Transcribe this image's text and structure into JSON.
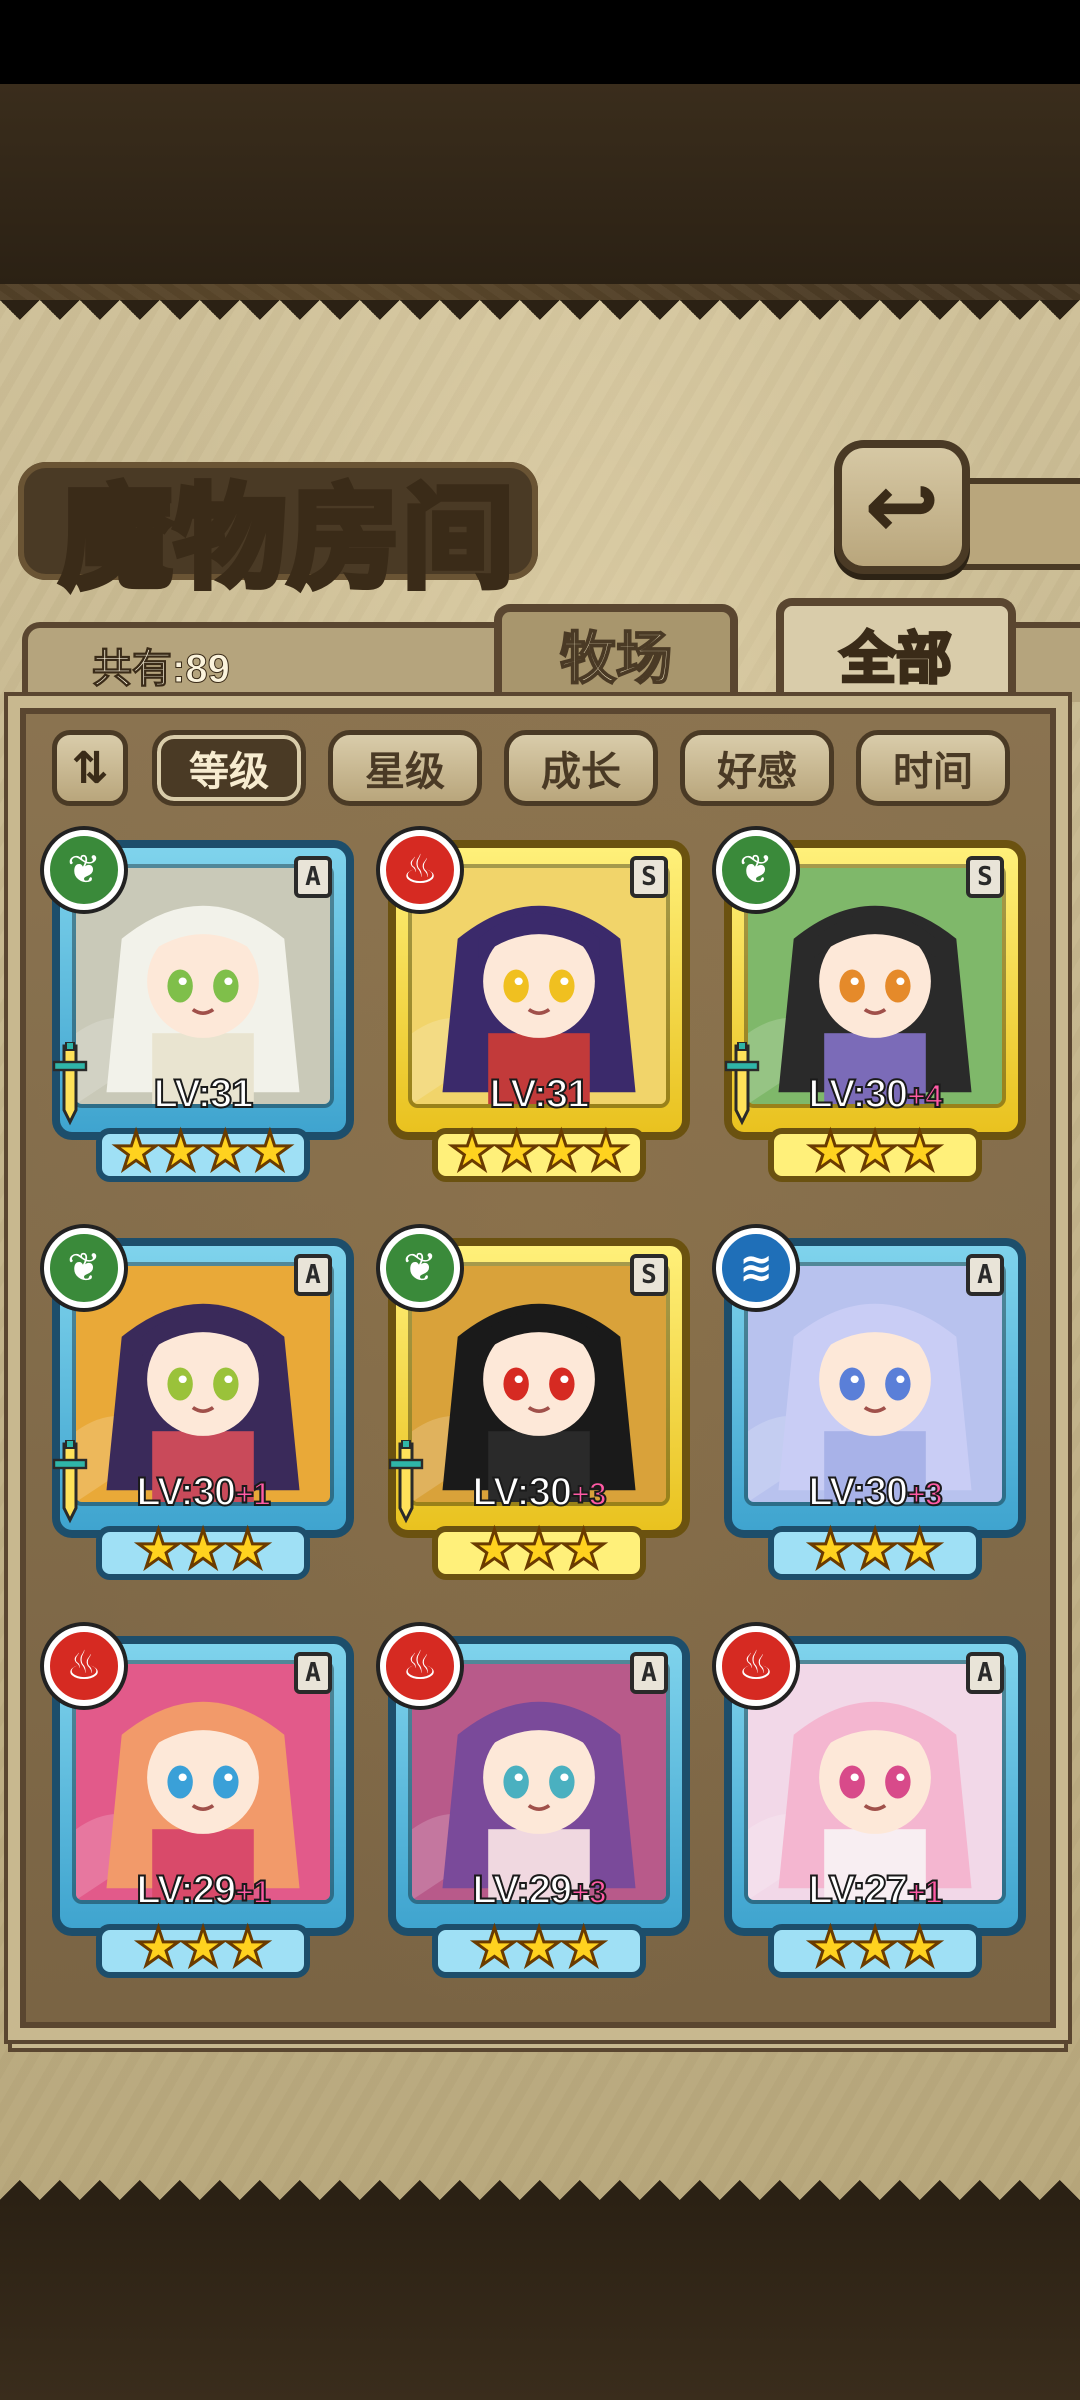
{
  "header": {
    "title": "魔物房间",
    "back_icon": "return-arrow-icon"
  },
  "tabs": {
    "count_label": "共有:89",
    "ranch_label": "牧场",
    "all_label": "全部"
  },
  "filters": {
    "sort_toggle_icon": "sort-order-icon",
    "sort_toggle_glyph": "⇅",
    "items": [
      {
        "label": "等级",
        "active": true
      },
      {
        "label": "星级",
        "active": false
      },
      {
        "label": "成长",
        "active": false
      },
      {
        "label": "好感",
        "active": false
      },
      {
        "label": "时间",
        "active": false
      }
    ]
  },
  "monsters": [
    {
      "element": "grass",
      "rank": "A",
      "frame": "blue",
      "level": "LV:31",
      "bonus": "",
      "stars": 4,
      "weapon": true
    },
    {
      "element": "fire",
      "rank": "S",
      "frame": "gold",
      "level": "LV:31",
      "bonus": "",
      "stars": 4,
      "weapon": false
    },
    {
      "element": "grass",
      "rank": "S",
      "frame": "gold",
      "level": "LV:30",
      "bonus": "+4",
      "stars": 3,
      "weapon": true
    },
    {
      "element": "grass",
      "rank": "A",
      "frame": "blue",
      "level": "LV:30",
      "bonus": "+1",
      "stars": 3,
      "weapon": true
    },
    {
      "element": "grass",
      "rank": "S",
      "frame": "gold",
      "level": "LV:30",
      "bonus": "+3",
      "stars": 3,
      "weapon": true
    },
    {
      "element": "water",
      "rank": "A",
      "frame": "blue",
      "level": "LV:30",
      "bonus": "+3",
      "stars": 3,
      "weapon": false
    },
    {
      "element": "fire",
      "rank": "A",
      "frame": "blue",
      "level": "LV:29",
      "bonus": "+1",
      "stars": 3,
      "weapon": false
    },
    {
      "element": "fire",
      "rank": "A",
      "frame": "blue",
      "level": "LV:29",
      "bonus": "+3",
      "stars": 3,
      "weapon": false
    },
    {
      "element": "fire",
      "rank": "A",
      "frame": "blue",
      "level": "LV:27",
      "bonus": "+1",
      "stars": 3,
      "weapon": false
    }
  ],
  "portraits": [
    {
      "bg": "#c9c9b8",
      "hair": "#f2f2ea",
      "eye": "#7fbf4a",
      "cloth": "#e9e4d0"
    },
    {
      "bg": "#f1d46a",
      "hair": "#3b2a6b",
      "eye": "#f0c020",
      "cloth": "#c23a3a"
    },
    {
      "bg": "#7fb86a",
      "hair": "#2a2a2a",
      "eye": "#e58a2a",
      "cloth": "#7b6bb8"
    },
    {
      "bg": "#e9a938",
      "hair": "#3a2a5a",
      "eye": "#9ac23a",
      "cloth": "#c94a5a"
    },
    {
      "bg": "#d9a23a",
      "hair": "#1a1a1a",
      "eye": "#d62a22",
      "cloth": "#2a2a2a"
    },
    {
      "bg": "#b8c2ee",
      "hair": "#c9cdf5",
      "eye": "#5a7fd8",
      "cloth": "#a8b2e8"
    },
    {
      "bg": "#e25a8a",
      "hair": "#f29a6a",
      "eye": "#3aa0d8",
      "cloth": "#d94a6a"
    },
    {
      "bg": "#b85a8a",
      "hair": "#7a4a9a",
      "eye": "#4ab0c0",
      "cloth": "#f0d8e0"
    },
    {
      "bg": "#f2d8e8",
      "hair": "#f4b6d0",
      "eye": "#d84a8a",
      "cloth": "#f8eef2"
    }
  ],
  "colors": {
    "grass": "#3a8a3a",
    "fire": "#d62a22",
    "water": "#1f6fb8",
    "star": "#ffd21f",
    "bonus": "#ff5aa5"
  },
  "element_glyphs": {
    "grass": "❦",
    "fire": "♨",
    "water": "≋"
  }
}
